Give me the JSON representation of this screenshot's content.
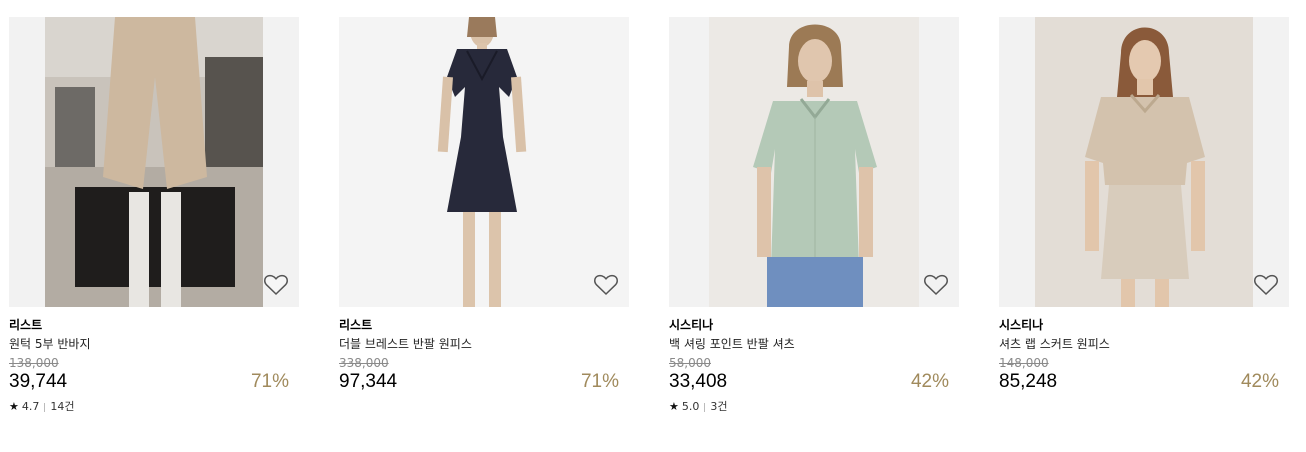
{
  "products": [
    {
      "brand": "리스트",
      "name": "원턱 5부 반바지",
      "original_price": "138,000",
      "price": "39,744",
      "discount": "71%",
      "rating": "4.7",
      "reviews": "14건",
      "bg_color": "#b8b2aa",
      "wishlist_icon": "heart-outline-icon"
    },
    {
      "brand": "리스트",
      "name": "더블 브레스트 반팔 원피스",
      "original_price": "338,000",
      "price": "97,344",
      "discount": "71%",
      "bg_color": "#f4f4f4",
      "wishlist_icon": "heart-outline-icon"
    },
    {
      "brand": "시스티나",
      "name": "백 셔링 포인트 반팔 셔츠",
      "original_price": "58,000",
      "price": "33,408",
      "discount": "42%",
      "rating": "5.0",
      "reviews": "3건",
      "bg_color": "#ece9e5",
      "wishlist_icon": "heart-outline-icon"
    },
    {
      "brand": "시스티나",
      "name": "셔츠 랩 스커트 원피스",
      "original_price": "148,000",
      "price": "85,248",
      "discount": "42%",
      "bg_color": "#e3ddd6",
      "wishlist_icon": "heart-outline-icon"
    }
  ],
  "colors": {
    "discount": "#a08a5c",
    "original_price": "#8a8a8a"
  }
}
